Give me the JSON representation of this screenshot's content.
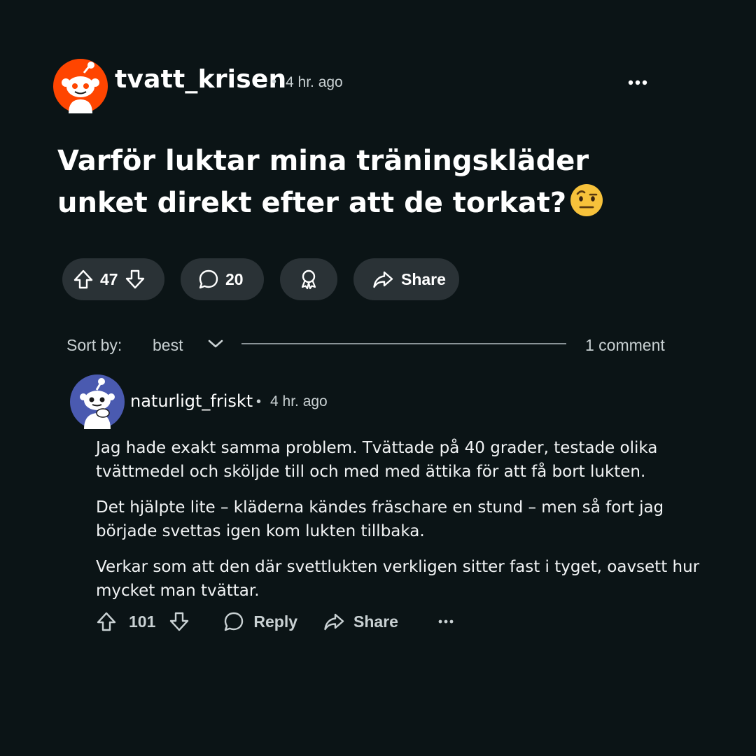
{
  "post": {
    "username": "tvatt_krisen",
    "separator": "•",
    "time": "4 hr. ago",
    "title": "Varför luktar mina träningskläder unket direkt efter att de torkat?",
    "title_emoji": "face-with-raised-eyebrow",
    "actions": {
      "votes": "47",
      "comments": "20",
      "share_label": "Share"
    }
  },
  "sort": {
    "label": "Sort by:",
    "value": "best",
    "comment_count": "1 comment"
  },
  "comment": {
    "username": "naturligt_friskt",
    "separator": "•",
    "time": "4 hr. ago",
    "paragraphs": [
      "Jag hade exakt samma problem. Tvättade på 40 grader, testade olika tvättmedel och sköljde till och med med ättika för att få bort lukten.",
      "Det hjälpte lite – kläderna kändes fräschare en stund – men så fort jag började svettas igen kom lukten tillbaka.",
      "Verkar som att den där svettlukten verkligen sitter fast i tyget, oavsett hur mycket man tvättar."
    ],
    "actions": {
      "votes": "101",
      "reply_label": "Reply",
      "share_label": "Share"
    }
  },
  "colors": {
    "background": "#0b1416",
    "pill": "#2a3236",
    "op_avatar": "#ff4500",
    "commenter_avatar": "#4a5ab0"
  }
}
